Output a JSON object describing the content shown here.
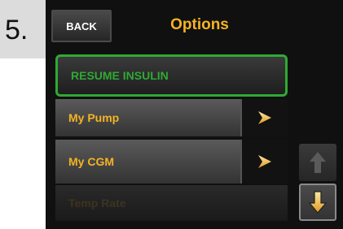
{
  "step": {
    "number": "5."
  },
  "header": {
    "back_label": "BACK",
    "title": "Options"
  },
  "menu": {
    "items": [
      {
        "label": "RESUME INSULIN",
        "state": "selected",
        "color": "#2fa934"
      },
      {
        "label": "My Pump",
        "has_arrow": true,
        "arrow_icon": "chevron-right-icon",
        "color": "#f5b324"
      },
      {
        "label": "My CGM",
        "has_arrow": true,
        "arrow_icon": "chevron-right-icon",
        "color": "#f5b324"
      },
      {
        "label": "Temp Rate",
        "state": "disabled",
        "color": "#3d3320"
      }
    ]
  },
  "scroll": {
    "up_icon": "arrow-up-icon",
    "down_icon": "arrow-down-icon",
    "up_enabled": false,
    "down_enabled": true
  },
  "colors": {
    "accent": "#f5b324",
    "selected": "#2fa934",
    "screen_bg": "#101010"
  }
}
